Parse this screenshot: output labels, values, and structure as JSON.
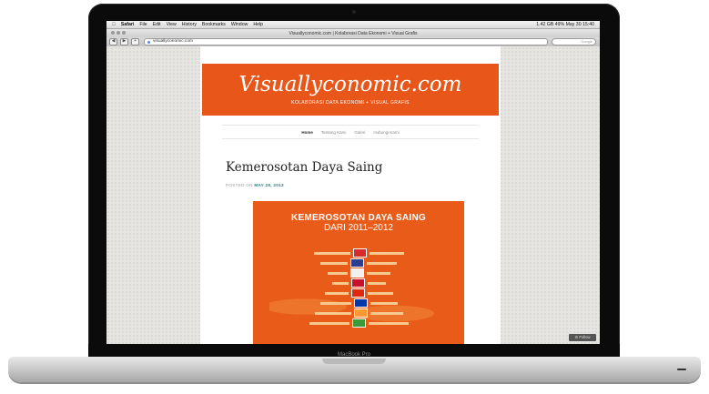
{
  "menubar": {
    "apple": "",
    "app": "Safari",
    "items": [
      "File",
      "Edit",
      "View",
      "History",
      "Bookmarks",
      "Window",
      "Help"
    ],
    "status": "1.42 GB  49% May 30  15:40"
  },
  "browser": {
    "window_title": "Visuallyconomic.com | Kolaborasi Data Ekonomi + Visual Grafis",
    "url": "visuallyconomic.com",
    "search_placeholder": "Google"
  },
  "site": {
    "title": "Visuallyconomic.com",
    "tagline": "KOLABORASI DATA EKONOMI + VISUAL GRAFIS",
    "nav": [
      "Home",
      "Tentang Kami",
      "Galeri",
      "Hubungi Kami"
    ]
  },
  "post": {
    "title": "Kemerosotan Daya Saing",
    "posted_prefix": "POSTED ON",
    "posted_date": "MAY 28, 2013"
  },
  "infographic": {
    "title": "KEMEROSOTAN DAYA SAING",
    "subtitle": "DARI 2011–2012"
  },
  "widgets": {
    "follow": "Follow"
  },
  "device": {
    "brand": "MacBook Pro"
  },
  "colors": {
    "accent": "#e8561a",
    "link": "#2a7a7c"
  }
}
